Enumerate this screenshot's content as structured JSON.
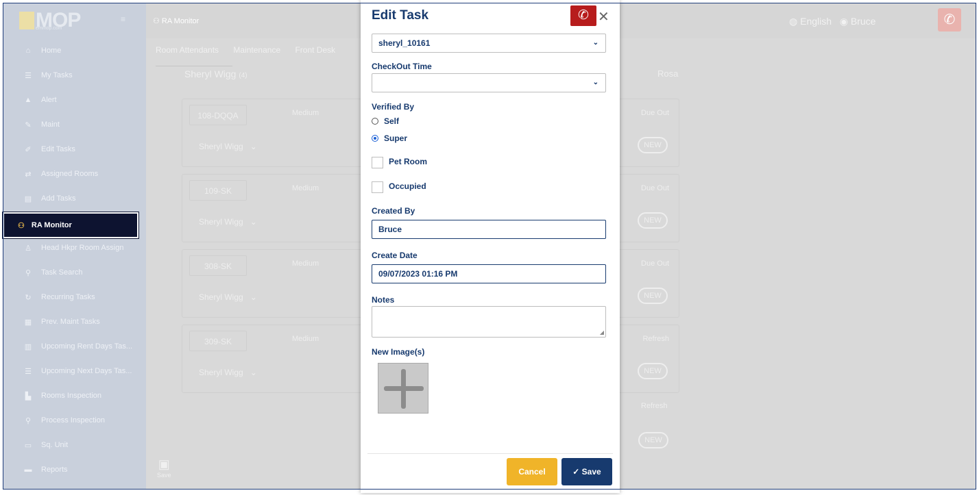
{
  "app": {
    "logo": "MOP",
    "logo_sub": "emmop.com"
  },
  "sidebar": {
    "items": [
      {
        "label": "Home",
        "icon": "home-icon",
        "glyph": "⌂"
      },
      {
        "label": "My Tasks",
        "icon": "list-icon",
        "glyph": "☰"
      },
      {
        "label": "Alert",
        "icon": "alert-icon",
        "glyph": "▲"
      },
      {
        "label": "Maint",
        "icon": "wrench-icon",
        "glyph": "✎"
      },
      {
        "label": "Edit Tasks",
        "icon": "edit-icon",
        "glyph": "✐"
      },
      {
        "label": "Assigned Rooms",
        "icon": "swap-icon",
        "glyph": "⇄"
      },
      {
        "label": "Add Tasks",
        "icon": "add-list-icon",
        "glyph": "▤"
      },
      {
        "label": "RA Monitor",
        "icon": "binoculars-icon",
        "glyph": "⚇"
      },
      {
        "label": "Head Hkpr Room Assign",
        "icon": "person-icon",
        "glyph": "♙"
      },
      {
        "label": "Task Search",
        "icon": "search-icon",
        "glyph": "⚲"
      },
      {
        "label": "Recurring Tasks",
        "icon": "refresh-icon",
        "glyph": "↻"
      },
      {
        "label": "Prev. Maint Tasks",
        "icon": "calendar-icon",
        "glyph": "▦"
      },
      {
        "label": "Upcoming Rent Days Tas...",
        "icon": "trash-icon",
        "glyph": "▥"
      },
      {
        "label": "Upcoming Next Days Tas...",
        "icon": "list-icon",
        "glyph": "☰"
      },
      {
        "label": "Rooms Inspection",
        "icon": "building-icon",
        "glyph": "▙"
      },
      {
        "label": "Process Inspection",
        "icon": "search-icon",
        "glyph": "⚲"
      },
      {
        "label": "Sq. Unit",
        "icon": "unit-icon",
        "glyph": "▭"
      },
      {
        "label": "Reports",
        "icon": "card-icon",
        "glyph": "▬"
      }
    ],
    "active": "RA Monitor"
  },
  "topbar": {
    "title": "RA Monitor",
    "language": "English",
    "user": "Bruce"
  },
  "main": {
    "tabs": [
      "Room Attendants",
      "Maintenance",
      "Front Desk"
    ],
    "attendant": "Sheryl Wigg",
    "attendant_count": "(4)",
    "other_attendant": "Rosa",
    "rooms": [
      {
        "no": "108-DQQA",
        "priority": "Medium",
        "status": "Due Out",
        "assignee": "Sheryl Wigg",
        "badge": "NEW"
      },
      {
        "no": "109-SK",
        "priority": "Medium",
        "status": "Due Out",
        "assignee": "Sheryl Wigg",
        "badge": "NEW"
      },
      {
        "no": "308-SK",
        "priority": "Medium",
        "status": "Due Out",
        "assignee": "Sheryl Wigg",
        "badge": "NEW"
      },
      {
        "no": "309-SK",
        "priority": "Medium",
        "status": "Refresh",
        "assignee": "Sheryl Wigg",
        "badge": "NEW"
      }
    ],
    "extra_status": "Refresh",
    "extra_badge": "NEW",
    "save_label": "Save"
  },
  "modal": {
    "title": "Edit Task",
    "assignee_value": "sheryl_10161",
    "checkout_label": "CheckOut Time",
    "checkout_value": "",
    "verified_label": "Verified By",
    "verified_options": [
      "Self",
      "Super"
    ],
    "verified_selected": "Super",
    "pet_room_label": "Pet Room",
    "pet_room_checked": false,
    "occupied_label": "Occupied",
    "occupied_checked": false,
    "created_by_label": "Created By",
    "created_by_value": "Bruce",
    "create_date_label": "Create Date",
    "create_date_value": "09/07/2023 01:16 PM",
    "notes_label": "Notes",
    "notes_value": "",
    "new_images_label": "New Image(s)",
    "cancel_label": "Cancel",
    "save_label": "Save"
  },
  "colors": {
    "brand_navy": "#173a6e",
    "cancel_yellow": "#f0b429",
    "phone_red": "#b71c1c",
    "sidebar_active": "#0d1330"
  }
}
